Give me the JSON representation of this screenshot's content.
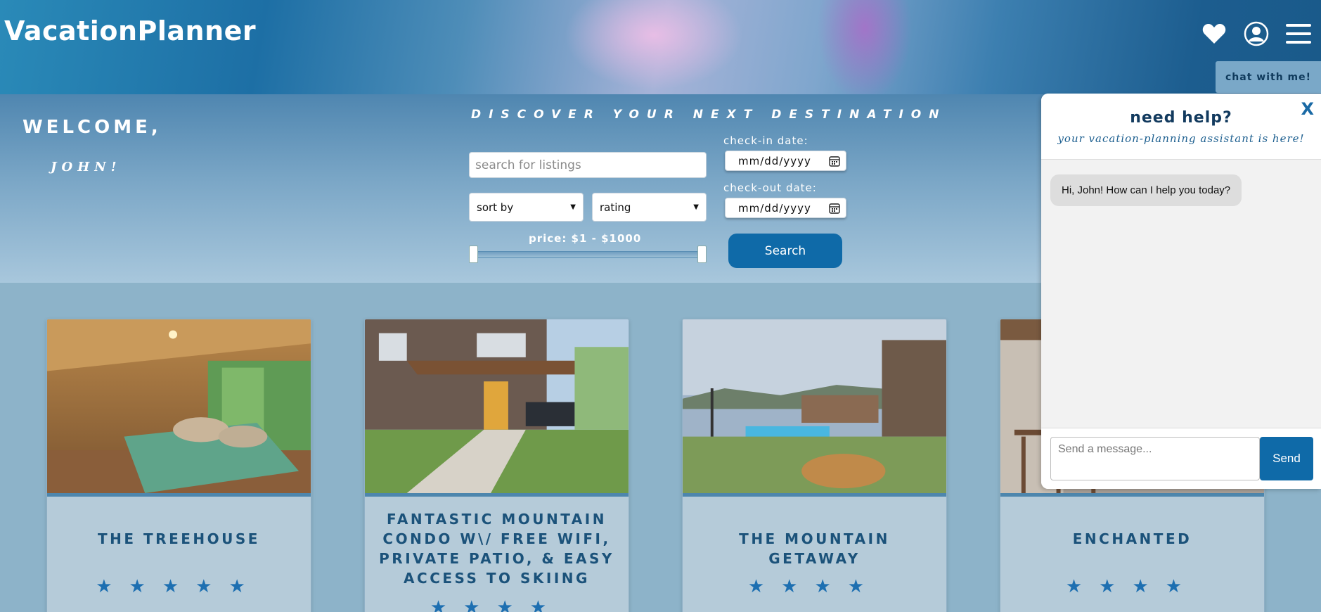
{
  "app": {
    "title": "VacationPlanner"
  },
  "nav": {
    "icons": [
      "heart-icon",
      "user-icon",
      "menu-icon"
    ]
  },
  "welcome": {
    "greeting": "WELCOME,",
    "name": "JOHN!"
  },
  "search": {
    "heading": "DISCOVER YOUR NEXT DESTINATION",
    "placeholder": "search for listings",
    "sort_by": "sort by",
    "sort_value": "rating",
    "price_label": "price: $1 - $1000",
    "price_min": 1,
    "price_max": 1000,
    "checkin_label": "check-in date:",
    "checkin_value": "mm/dd/yyyy",
    "checkout_label": "check-out date:",
    "checkout_value": "mm/dd/yyyy",
    "button": "Search"
  },
  "listings": [
    {
      "title": "THE TREEHOUSE",
      "rating": 5,
      "stars": "★★★★★"
    },
    {
      "title": "FANTASTIC MOUNTAIN CONDO W\\/ FREE WIFI, PRIVATE PATIO, & EASY ACCESS TO SKIING",
      "rating": 4,
      "stars": "★★★★"
    },
    {
      "title": "THE MOUNTAIN GETAWAY",
      "rating": 4,
      "stars": "★★★★"
    },
    {
      "title": "ENCHANTED",
      "rating": 4,
      "stars": "★★★★"
    }
  ],
  "chat": {
    "tab_label": "chat with me!",
    "title": "need help?",
    "subtitle": "your vacation-planning assistant is here!",
    "close": "X",
    "messages": [
      {
        "from": "assistant",
        "text": "Hi, John! How can I help you today?"
      }
    ],
    "input_placeholder": "Send a message...",
    "send": "Send"
  },
  "colors": {
    "accent": "#0f6aa8",
    "star": "#1d6fb1",
    "title": "#1b527a"
  }
}
